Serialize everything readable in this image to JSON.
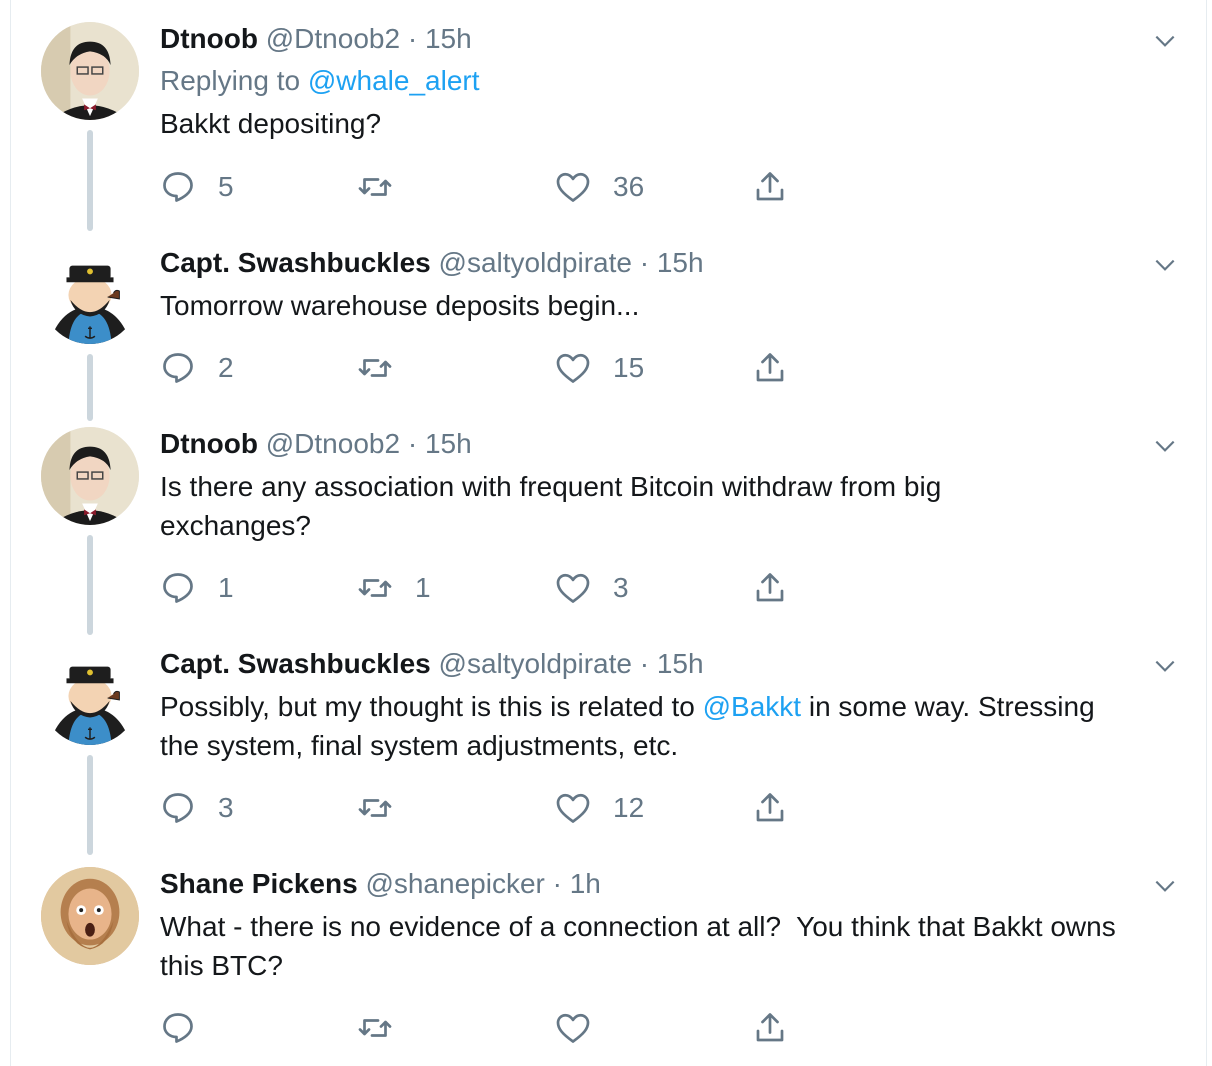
{
  "colors": {
    "link": "#1da1f2",
    "muted": "#657786",
    "text": "#14171a",
    "thread_line": "#ccd6dd"
  },
  "tweets": [
    {
      "name": "Dtnoob",
      "handle": "@Dtnoob2",
      "time": "15h",
      "reply_prefix": "Replying to",
      "reply_to": "@whale_alert",
      "text": "Bakkt depositing?",
      "reply_count": "5",
      "retweet_count": "",
      "like_count": "36"
    },
    {
      "name": "Capt. Swashbuckles",
      "handle": "@saltyoldpirate",
      "time": "15h",
      "text": "Tomorrow warehouse deposits begin...",
      "reply_count": "2",
      "retweet_count": "",
      "like_count": "15"
    },
    {
      "name": "Dtnoob",
      "handle": "@Dtnoob2",
      "time": "15h",
      "text_line1": "Is there any association with frequent Bitcoin withdraw from big",
      "text_line2": "exchanges?",
      "reply_count": "1",
      "retweet_count": "1",
      "like_count": "3"
    },
    {
      "name": "Capt. Swashbuckles",
      "handle": "@saltyoldpirate",
      "time": "15h",
      "text_before": "Possibly, but my thought is this is related to ",
      "mention": "@Bakkt",
      "text_after": " in some way. Stressing",
      "text_line2": "the system, final system adjustments, etc.",
      "reply_count": "3",
      "retweet_count": "",
      "like_count": "12"
    },
    {
      "name": "Shane Pickens",
      "handle": "@shanepicker",
      "time": "1h",
      "text_line1": "What - there is no evidence of a connection at all?  You think that Bakkt owns",
      "text_line2": "this BTC?",
      "reply_count": "",
      "retweet_count": "",
      "like_count": ""
    }
  ]
}
